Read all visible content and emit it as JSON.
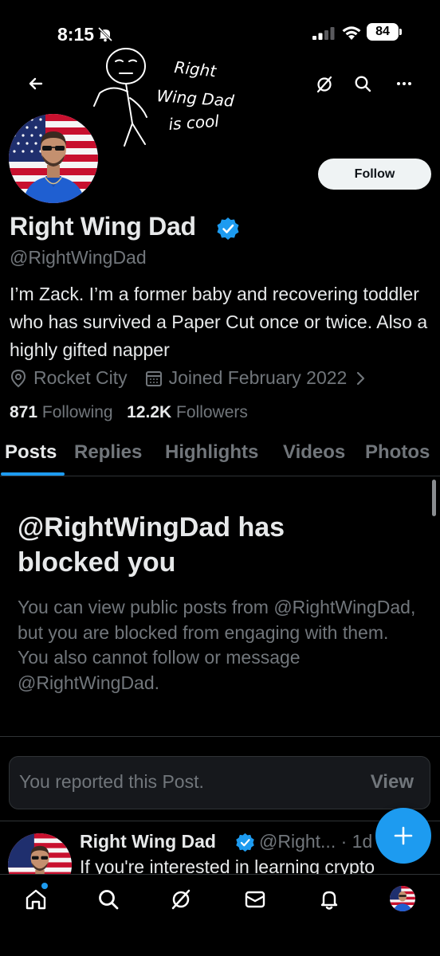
{
  "status": {
    "time": "8:15",
    "battery": "84"
  },
  "sketch": {
    "line1": "Right",
    "line2": "Wing Dad",
    "line3": "is cool"
  },
  "profile": {
    "name": "Right Wing Dad",
    "handle": "@RightWingDad",
    "bio": "I’m Zack. I’m a former baby and recovering toddler who has survived a Paper Cut once or twice. Also a highly gifted napper",
    "location": "Rocket City",
    "joined": "Joined February 2022",
    "following_count": "871",
    "following_label": "Following",
    "followers_count": "12.2K",
    "followers_label": "Followers",
    "follow_button": "Follow"
  },
  "tabs": [
    "Posts",
    "Replies",
    "Highlights",
    "Videos",
    "Photos"
  ],
  "blocked": {
    "title": "@RightWingDad has blocked you",
    "body": "You can view public posts from @RightWingDad, but you are blocked from engaging with them. You also cannot follow or message @RightWingDad."
  },
  "report": {
    "text": "You reported this Post.",
    "action": "View"
  },
  "post": {
    "name": "Right Wing Dad",
    "handle": "@Right... · 1d",
    "text": "If you're interested in learning crypto"
  },
  "icons": {
    "back": "back-arrow-icon",
    "grok": "grok-icon",
    "search": "search-icon",
    "more": "more-icon",
    "nav": [
      "home-icon",
      "search-icon",
      "grok-icon",
      "messages-icon",
      "notifications-icon"
    ]
  },
  "colors": {
    "accent": "#1d9bf0",
    "background": "#000000",
    "muted": "#71767b"
  }
}
